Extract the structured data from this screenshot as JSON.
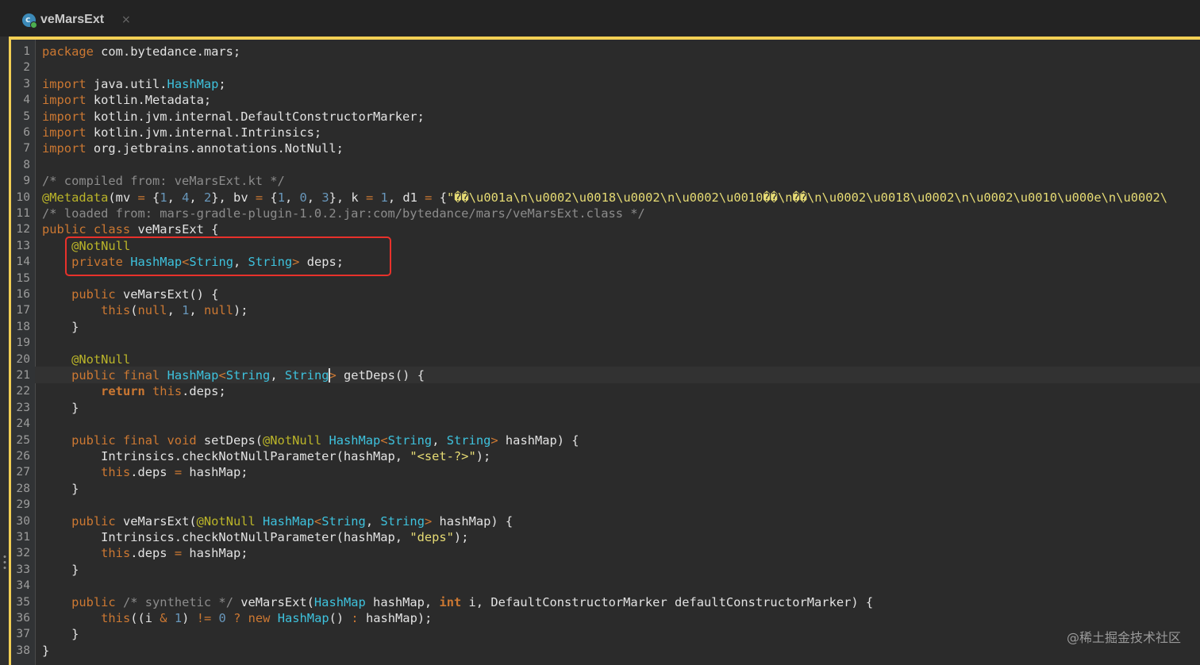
{
  "tab": {
    "title": "veMarsExt",
    "icon": "kotlin-class-icon",
    "close": "×"
  },
  "colors": {
    "accent": "#f2cf54",
    "keyword": "#cc7832",
    "type": "#3ec2dd",
    "annotation": "#bbb529",
    "number": "#6897bb",
    "string": "#e6db74",
    "comment": "#8c8c8c",
    "highlight_box": "#e8312b"
  },
  "line_numbers": [
    "1",
    "2",
    "3",
    "4",
    "5",
    "6",
    "7",
    "8",
    "9",
    "10",
    "11",
    "12",
    "13",
    "14",
    "15",
    "16",
    "17",
    "18",
    "19",
    "20",
    "21",
    "22",
    "23",
    "24",
    "25",
    "26",
    "27",
    "28",
    "29",
    "30",
    "31",
    "32",
    "33",
    "34",
    "35",
    "36",
    "37",
    "38"
  ],
  "lines": [
    [
      {
        "c": "kw",
        "t": "package"
      },
      {
        "t": " com.bytedance.mars;"
      }
    ],
    [],
    [
      {
        "c": "kw",
        "t": "import"
      },
      {
        "t": " java.util."
      },
      {
        "c": "ty",
        "t": "HashMap"
      },
      {
        "t": ";"
      }
    ],
    [
      {
        "c": "kw",
        "t": "import"
      },
      {
        "t": " kotlin.Metadata;"
      }
    ],
    [
      {
        "c": "kw",
        "t": "import"
      },
      {
        "t": " kotlin.jvm.internal.DefaultConstructorMarker;"
      }
    ],
    [
      {
        "c": "kw",
        "t": "import"
      },
      {
        "t": " kotlin.jvm.internal.Intrinsics;"
      }
    ],
    [
      {
        "c": "kw",
        "t": "import"
      },
      {
        "t": " org.jetbrains.annotations.NotNull;"
      }
    ],
    [],
    [
      {
        "c": "cm",
        "t": "/* compiled from: veMarsExt.kt */"
      }
    ],
    [
      {
        "c": "an",
        "t": "@Metadata"
      },
      {
        "t": "(mv "
      },
      {
        "c": "kw",
        "t": "="
      },
      {
        "t": " {"
      },
      {
        "c": "num",
        "t": "1"
      },
      {
        "t": ", "
      },
      {
        "c": "num",
        "t": "4"
      },
      {
        "t": ", "
      },
      {
        "c": "num",
        "t": "2"
      },
      {
        "t": "}, bv "
      },
      {
        "c": "kw",
        "t": "="
      },
      {
        "t": " {"
      },
      {
        "c": "num",
        "t": "1"
      },
      {
        "t": ", "
      },
      {
        "c": "num",
        "t": "0"
      },
      {
        "t": ", "
      },
      {
        "c": "num",
        "t": "3"
      },
      {
        "t": "}, k "
      },
      {
        "c": "kw",
        "t": "="
      },
      {
        "t": " "
      },
      {
        "c": "num",
        "t": "1"
      },
      {
        "t": ", d1 "
      },
      {
        "c": "kw",
        "t": "="
      },
      {
        "t": " {"
      },
      {
        "c": "str",
        "t": "\"��\\u001a\\n\\u0002\\u0018\\u0002\\n\\u0002\\u0010��\\n��\\n\\u0002\\u0018\\u0002\\n\\u0002\\u0010\\u000e\\n\\u0002\\"
      }
    ],
    [
      {
        "c": "cm",
        "t": "/* loaded from: mars-gradle-plugin-1.0.2.jar:com/bytedance/mars/veMarsExt.class */"
      }
    ],
    [
      {
        "c": "kw",
        "t": "public class"
      },
      {
        "t": " veMarsExt {"
      }
    ],
    [
      {
        "t": "    "
      },
      {
        "c": "an",
        "t": "@NotNull"
      }
    ],
    [
      {
        "t": "    "
      },
      {
        "c": "kw",
        "t": "private"
      },
      {
        "t": " "
      },
      {
        "c": "ty",
        "t": "HashMap"
      },
      {
        "c": "kw",
        "t": "<"
      },
      {
        "c": "ty",
        "t": "String"
      },
      {
        "t": ", "
      },
      {
        "c": "ty",
        "t": "String"
      },
      {
        "c": "kw",
        "t": ">"
      },
      {
        "t": " deps;"
      }
    ],
    [],
    [
      {
        "t": "    "
      },
      {
        "c": "kw",
        "t": "public"
      },
      {
        "t": " veMarsExt() {"
      }
    ],
    [
      {
        "t": "        "
      },
      {
        "c": "kw",
        "t": "this"
      },
      {
        "t": "("
      },
      {
        "c": "kw",
        "t": "null"
      },
      {
        "t": ", "
      },
      {
        "c": "num",
        "t": "1"
      },
      {
        "t": ", "
      },
      {
        "c": "kw",
        "t": "null"
      },
      {
        "t": ");"
      }
    ],
    [
      {
        "t": "    }"
      }
    ],
    [],
    [
      {
        "t": "    "
      },
      {
        "c": "an",
        "t": "@NotNull"
      }
    ],
    [
      {
        "t": "    "
      },
      {
        "c": "kw",
        "t": "public final"
      },
      {
        "t": " "
      },
      {
        "c": "ty",
        "t": "HashMap"
      },
      {
        "c": "kw",
        "t": "<"
      },
      {
        "c": "ty",
        "t": "String"
      },
      {
        "t": ", "
      },
      {
        "c": "ty",
        "t": "String"
      },
      {
        "c": "kw",
        "t": ">"
      },
      {
        "t": " getDeps() {"
      }
    ],
    [
      {
        "t": "        "
      },
      {
        "c": "kw bold",
        "t": "return"
      },
      {
        "t": " "
      },
      {
        "c": "kw",
        "t": "this"
      },
      {
        "t": ".deps;"
      }
    ],
    [
      {
        "t": "    }"
      }
    ],
    [],
    [
      {
        "t": "    "
      },
      {
        "c": "kw",
        "t": "public final void"
      },
      {
        "t": " setDeps("
      },
      {
        "c": "an",
        "t": "@NotNull"
      },
      {
        "t": " "
      },
      {
        "c": "ty",
        "t": "HashMap"
      },
      {
        "c": "kw",
        "t": "<"
      },
      {
        "c": "ty",
        "t": "String"
      },
      {
        "t": ", "
      },
      {
        "c": "ty",
        "t": "String"
      },
      {
        "c": "kw",
        "t": ">"
      },
      {
        "t": " hashMap) {"
      }
    ],
    [
      {
        "t": "        Intrinsics.checkNotNullParameter(hashMap, "
      },
      {
        "c": "str",
        "t": "\"<set-?>\""
      },
      {
        "t": ");"
      }
    ],
    [
      {
        "t": "        "
      },
      {
        "c": "kw",
        "t": "this"
      },
      {
        "t": ".deps "
      },
      {
        "c": "kw",
        "t": "="
      },
      {
        "t": " hashMap;"
      }
    ],
    [
      {
        "t": "    }"
      }
    ],
    [],
    [
      {
        "t": "    "
      },
      {
        "c": "kw",
        "t": "public"
      },
      {
        "t": " veMarsExt("
      },
      {
        "c": "an",
        "t": "@NotNull"
      },
      {
        "t": " "
      },
      {
        "c": "ty",
        "t": "HashMap"
      },
      {
        "c": "kw",
        "t": "<"
      },
      {
        "c": "ty",
        "t": "String"
      },
      {
        "t": ", "
      },
      {
        "c": "ty",
        "t": "String"
      },
      {
        "c": "kw",
        "t": ">"
      },
      {
        "t": " hashMap) {"
      }
    ],
    [
      {
        "t": "        Intrinsics.checkNotNullParameter(hashMap, "
      },
      {
        "c": "str",
        "t": "\"deps\""
      },
      {
        "t": ");"
      }
    ],
    [
      {
        "t": "        "
      },
      {
        "c": "kw",
        "t": "this"
      },
      {
        "t": ".deps "
      },
      {
        "c": "kw",
        "t": "="
      },
      {
        "t": " hashMap;"
      }
    ],
    [
      {
        "t": "    }"
      }
    ],
    [],
    [
      {
        "t": "    "
      },
      {
        "c": "kw",
        "t": "public"
      },
      {
        "t": " "
      },
      {
        "c": "cm",
        "t": "/* synthetic */"
      },
      {
        "t": " veMarsExt("
      },
      {
        "c": "ty",
        "t": "HashMap"
      },
      {
        "t": " hashMap, "
      },
      {
        "c": "kw bold",
        "t": "int"
      },
      {
        "t": " i, DefaultConstructorMarker defaultConstructorMarker) {"
      }
    ],
    [
      {
        "t": "        "
      },
      {
        "c": "kw",
        "t": "this"
      },
      {
        "t": "((i "
      },
      {
        "c": "kw",
        "t": "&"
      },
      {
        "t": " "
      },
      {
        "c": "num",
        "t": "1"
      },
      {
        "t": ") "
      },
      {
        "c": "kw",
        "t": "!="
      },
      {
        "t": " "
      },
      {
        "c": "num",
        "t": "0"
      },
      {
        "t": " "
      },
      {
        "c": "kw",
        "t": "?"
      },
      {
        "t": " "
      },
      {
        "c": "kw",
        "t": "new"
      },
      {
        "t": " "
      },
      {
        "c": "ty",
        "t": "HashMap"
      },
      {
        "t": "() "
      },
      {
        "c": "kw",
        "t": ":"
      },
      {
        "t": " hashMap);"
      }
    ],
    [
      {
        "t": "    }"
      }
    ],
    [
      {
        "t": "}"
      }
    ]
  ],
  "watermark": "@稀土掘金技术社区"
}
